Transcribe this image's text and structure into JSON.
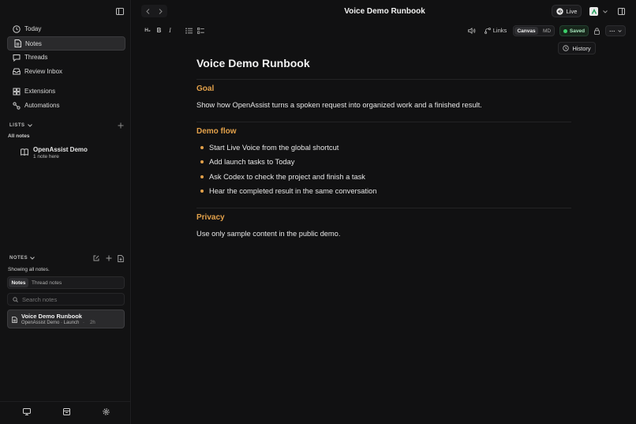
{
  "sidebar": {
    "nav": [
      {
        "label": "Today",
        "icon": "clock-icon"
      },
      {
        "label": "Notes",
        "icon": "note-icon"
      },
      {
        "label": "Threads",
        "icon": "chat-icon"
      },
      {
        "label": "Review Inbox",
        "icon": "inbox-icon"
      },
      {
        "label": "Extensions",
        "icon": "extensions-icon"
      },
      {
        "label": "Automations",
        "icon": "automation-icon"
      }
    ],
    "lists_heading": "LISTS",
    "all_notes": "All notes",
    "list_item": {
      "title": "OpenAssist Demo",
      "subtitle": "1 note here"
    },
    "notes_heading": "NOTES",
    "showing": "Showing all notes.",
    "tabs": [
      "Notes",
      "Thread notes"
    ],
    "search_placeholder": "Search notes",
    "note_item": {
      "title": "Voice Demo Runbook",
      "meta": "OpenAssist Demo · Launch",
      "age": "2h"
    }
  },
  "header": {
    "title": "Voice Demo Runbook",
    "live_label": "Live"
  },
  "toolbar": {
    "heading_btn": "H₂",
    "bold_btn": "B",
    "italic_btn": "I",
    "links_label": "Links",
    "view_modes": [
      "Canvas",
      "MD"
    ],
    "saved_label": "Saved",
    "history_label": "History",
    "more_label": "···"
  },
  "document": {
    "title": "Voice Demo Runbook",
    "sections": [
      {
        "heading": "Goal",
        "text": "Show how OpenAssist turns a spoken request into organized work and a finished result."
      },
      {
        "heading": "Demo flow",
        "bullets": [
          "Start Live Voice from the global shortcut",
          "Add launch tasks to Today",
          "Ask Codex to check the project and finish a task",
          "Hear the completed result in the same conversation"
        ]
      },
      {
        "heading": "Privacy",
        "text": "Use only sample content in the public demo."
      }
    ]
  },
  "colors": {
    "accent_heading": "#e3a14a",
    "saved_dot": "#3ccf6a",
    "background": "#111112"
  }
}
